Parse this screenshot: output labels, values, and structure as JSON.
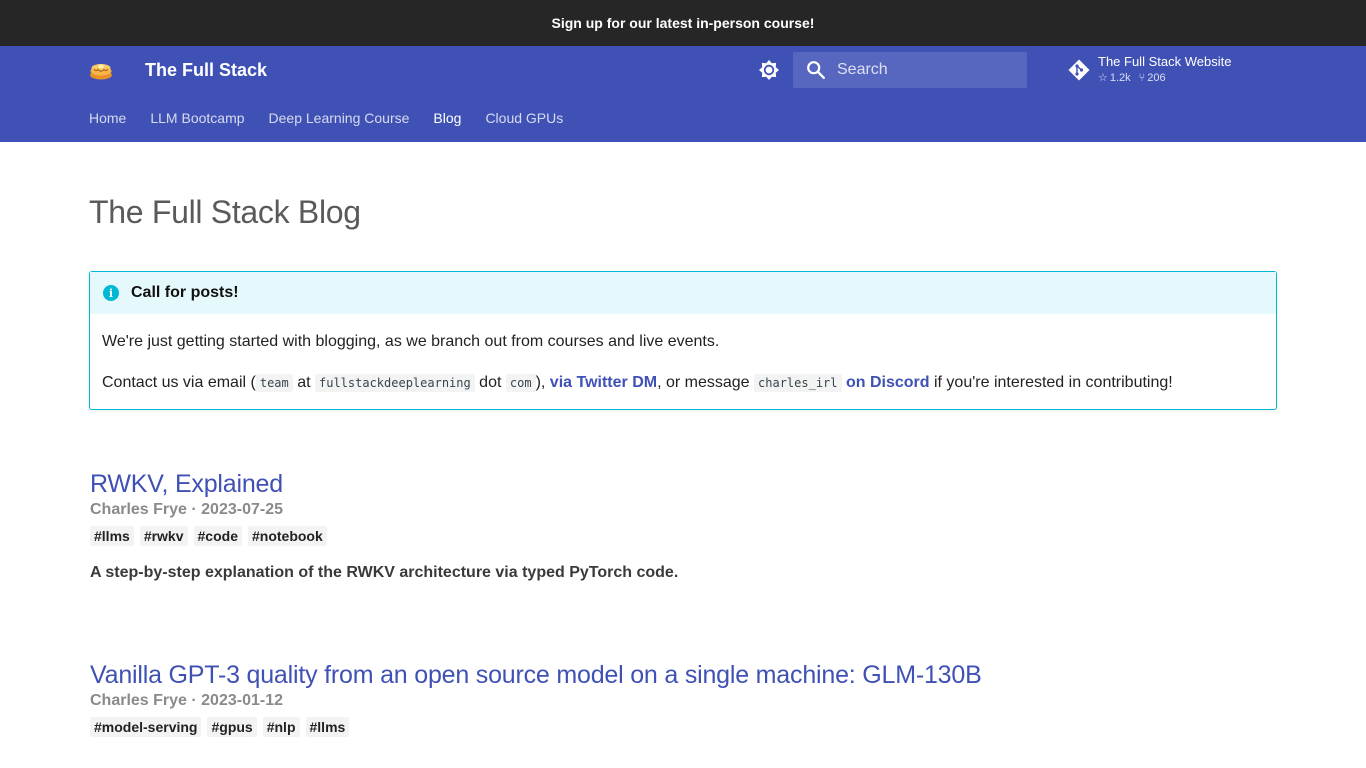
{
  "announcement": {
    "text": "Sign up for our latest in-person course!"
  },
  "header": {
    "site_title": "The Full Stack",
    "logo_icon": "pancake-stack-logo",
    "theme_toggle_icon": "brightness-icon",
    "search": {
      "placeholder": "Search",
      "value": ""
    },
    "repo": {
      "name": "The Full Stack Website",
      "stars": "1.2k",
      "forks": "206"
    }
  },
  "nav": {
    "tabs": [
      {
        "label": "Home",
        "active": false
      },
      {
        "label": "LLM Bootcamp",
        "active": false
      },
      {
        "label": "Deep Learning Course",
        "active": false
      },
      {
        "label": "Blog",
        "active": true
      },
      {
        "label": "Cloud GPUs",
        "active": false
      }
    ]
  },
  "page": {
    "title": "The Full Stack Blog"
  },
  "callout": {
    "title": "Call for posts!",
    "line1": "We're just getting started with blogging, as we branch out from courses and live events.",
    "line2": {
      "t1": "Contact us via email (",
      "c1": "team",
      "t2": "at",
      "c2": "fullstackdeeplearning",
      "t3": "dot",
      "c3": "com",
      "t4": "),",
      "link1": "via Twitter DM",
      "t5": ", or message",
      "c4": "charles_irl",
      "link2": "on Discord",
      "t6": "if you're interested in contributing!"
    }
  },
  "posts": [
    {
      "title": "RWKV, Explained",
      "meta": "Charles Frye · 2023-07-25",
      "tags": [
        "#llms",
        "#rwkv",
        "#code",
        "#notebook"
      ],
      "description": "A step-by-step explanation of the RWKV architecture via typed PyTorch code."
    },
    {
      "title": "Vanilla GPT-3 quality from an open source model on a single machine: GLM-130B",
      "meta": "Charles Frye · 2023-01-12",
      "tags": [
        "#model-serving",
        "#gpus",
        "#nlp",
        "#llms"
      ]
    }
  ],
  "colors": {
    "primary": "#4051b5",
    "announce_bg": "#262626",
    "info": "#00b8d4",
    "info_bg": "#e5f8fb"
  }
}
